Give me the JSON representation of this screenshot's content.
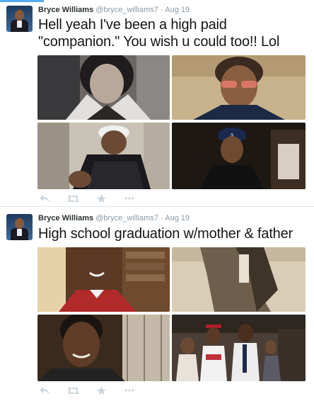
{
  "tweets": [
    {
      "name": "Bryce Williams",
      "handle": "@bryce_williams7",
      "separator": "·",
      "date": "Aug 19",
      "text": "Hell yeah I've been a high paid \"companion.\" You wish u could too!! Lol",
      "actions": [
        "reply-icon",
        "retweet-icon",
        "favorite-icon",
        "more-icon"
      ]
    },
    {
      "name": "Bryce Williams",
      "handle": "@bryce_williams7",
      "separator": "·",
      "date": "Aug 19",
      "text": "High school graduation w/mother & father",
      "actions": [
        "reply-icon",
        "retweet-icon",
        "favorite-icon",
        "more-icon"
      ]
    }
  ],
  "colors": {
    "accent": "#55acee",
    "name": "#292f33",
    "meta": "#8899a6",
    "action_icon": "#ccd6dd",
    "divider": "#e1e8ed"
  }
}
